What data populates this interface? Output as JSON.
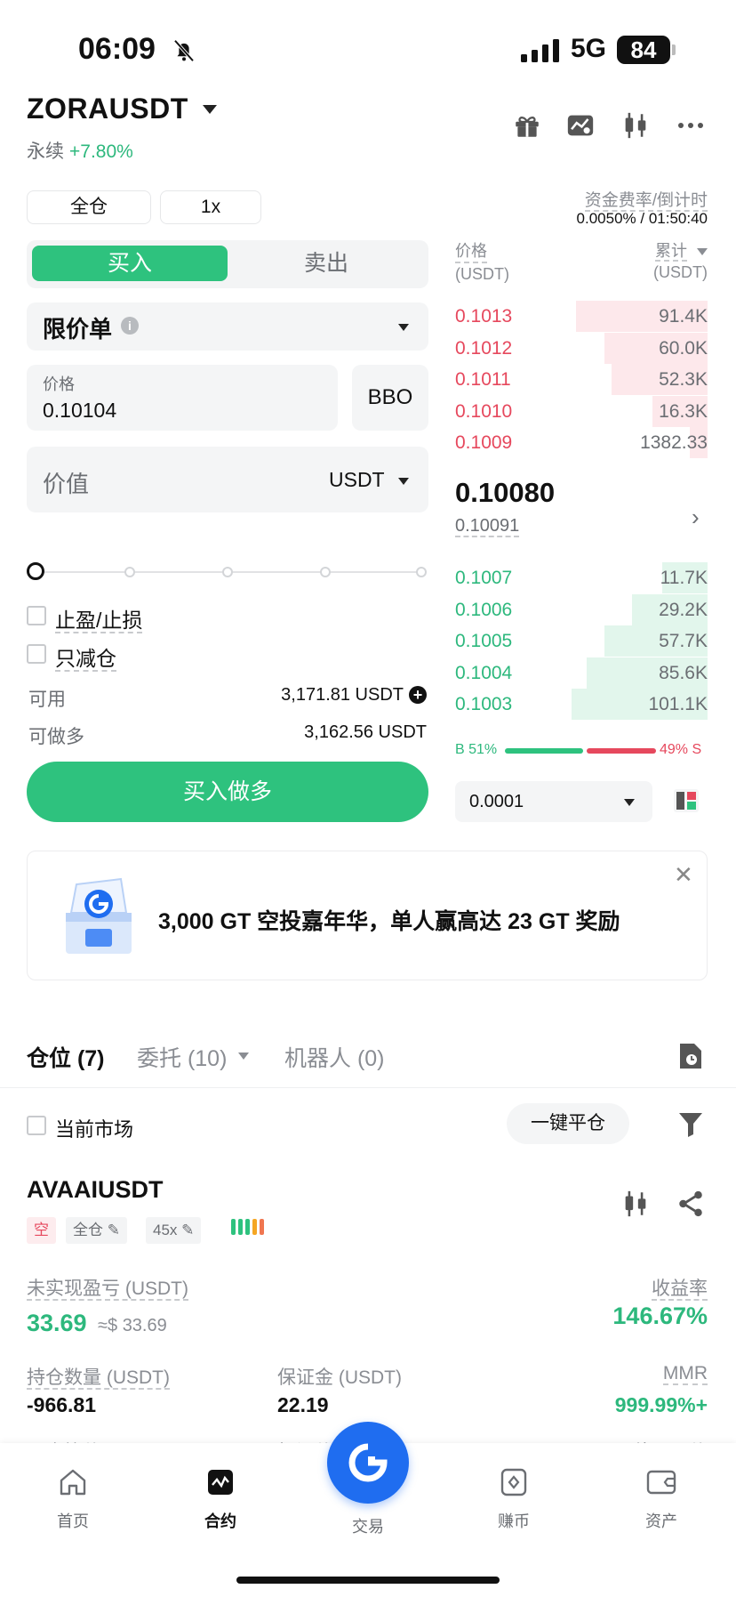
{
  "status_bar": {
    "time": "06:09",
    "network": "5G",
    "battery": "84"
  },
  "header": {
    "symbol": "ZORAUSDT",
    "contract_type": "永续",
    "change": "+7.80%"
  },
  "margin_mode": "全仓",
  "leverage": "1x",
  "funding": {
    "label": "资金费率/倒计时",
    "value": "0.0050% / 01:50:40"
  },
  "side_tabs": {
    "buy": "买入",
    "sell": "卖出"
  },
  "order_type": "限价单",
  "price_field": {
    "label": "价格",
    "value": "0.10104"
  },
  "bbo_label": "BBO",
  "value_field": {
    "label": "价值",
    "unit": "USDT"
  },
  "checkboxes": {
    "tp_sl": "止盈/止损",
    "reduce_only": "只减仓"
  },
  "available": {
    "label": "可用",
    "value": "3,171.81 USDT"
  },
  "max_long": {
    "label": "可做多",
    "value": "3,162.56 USDT"
  },
  "submit_label": "买入做多",
  "order_book": {
    "price_header": "价格",
    "price_unit": "(USDT)",
    "total_header": "累计",
    "total_unit": "(USDT)",
    "asks": [
      {
        "price": "0.1013",
        "qty": "91.4K",
        "depth": 0.52
      },
      {
        "price": "0.1012",
        "qty": "60.0K",
        "depth": 0.41
      },
      {
        "price": "0.1011",
        "qty": "52.3K",
        "depth": 0.38
      },
      {
        "price": "0.1010",
        "qty": "16.3K",
        "depth": 0.22
      },
      {
        "price": "0.1009",
        "qty": "1382.33",
        "depth": 0.07
      }
    ],
    "mark_price": "0.10080",
    "index_price": "0.10091",
    "bids": [
      {
        "price": "0.1007",
        "qty": "11.7K",
        "depth": 0.18
      },
      {
        "price": "0.1006",
        "qty": "29.2K",
        "depth": 0.3
      },
      {
        "price": "0.1005",
        "qty": "57.7K",
        "depth": 0.41
      },
      {
        "price": "0.1004",
        "qty": "85.6K",
        "depth": 0.48
      },
      {
        "price": "0.1003",
        "qty": "101.1K",
        "depth": 0.54
      }
    ],
    "buy_ratio": "B 51%",
    "sell_ratio": "49% S",
    "precision": "0.0001"
  },
  "banner": {
    "text": "3,000 GT 空投嘉年华，单人赢高达 23 GT 奖励"
  },
  "position_tabs": [
    {
      "label": "仓位 (7)"
    },
    {
      "label": "委托 (10)"
    },
    {
      "label": "机器人 (0)"
    }
  ],
  "current_market_label": "当前市场",
  "close_all_label": "一键平仓",
  "position": {
    "symbol": "AVAAIUSDT",
    "side": "空",
    "margin_mode": "全仓",
    "leverage": "45x",
    "upnl_label": "未实现盈亏 (USDT)",
    "upnl": "33.69",
    "upnl_usd": "≈$ 33.69",
    "roe_label": "收益率",
    "roe": "146.67%",
    "size_label": "持仓数量 (USDT)",
    "size": "-966.81",
    "margin_label": "保证金 (USDT)",
    "margin": "22.19",
    "mmr_label": "MMR",
    "mmr": "999.99%+",
    "entry_label": "开仓均价",
    "mark_label": "标记价",
    "liq_label": "预估强平价"
  },
  "bottom_nav": [
    {
      "label": "首页"
    },
    {
      "label": "合约"
    },
    {
      "label": "交易"
    },
    {
      "label": "赚币"
    },
    {
      "label": "资产"
    }
  ],
  "colors": {
    "buy": "#2ec27e",
    "sell": "#e6485d",
    "brand": "#1f6df0"
  }
}
